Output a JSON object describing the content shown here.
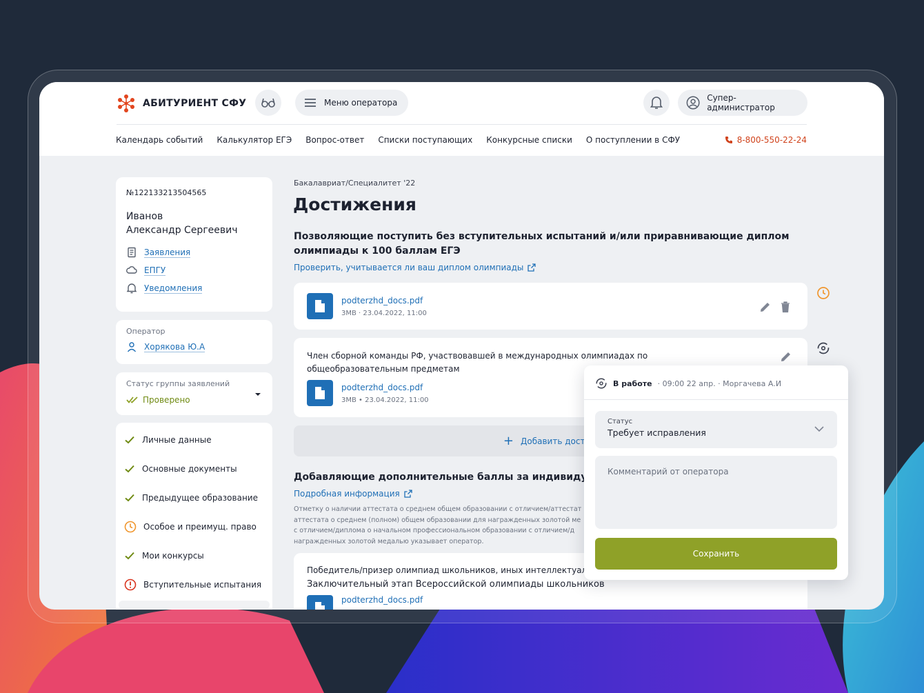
{
  "header": {
    "logo_text": "АБИТУРИЕНТ СФУ",
    "operator_menu_label": "Меню оператора",
    "user_label": "Супер-администратор",
    "nav": [
      "Календарь событий",
      "Калькулятор ЕГЭ",
      "Вопрос-ответ",
      "Списки поступающих",
      "Конкурсные списки",
      "О поступлении в СФУ"
    ],
    "phone": "8-800-550-22-24"
  },
  "profile": {
    "number": "№122133213504565",
    "last_name": "Иванов",
    "full_name": "Александр Сергеевич",
    "links": [
      "Заявления",
      "ЕПГУ",
      "Уведомления"
    ]
  },
  "operator": {
    "label": "Оператор",
    "name": "Хорякова Ю.А"
  },
  "group_status": {
    "label": "Статус группы заявлений",
    "value": "Проверено"
  },
  "steps": [
    {
      "label": "Личные данные",
      "state": "done"
    },
    {
      "label": "Основные документы",
      "state": "done"
    },
    {
      "label": "Предыдущее образование",
      "state": "done"
    },
    {
      "label": "Особое и преимущ. право",
      "state": "pending"
    },
    {
      "label": "Мои конкурсы",
      "state": "done"
    },
    {
      "label": "Вступительные испытания",
      "state": "error"
    }
  ],
  "main": {
    "breadcrumb": "Бакалавриат/Специалитет '22",
    "title": "Достижения",
    "section1_title": "Позволяющие поступить без вступительных испытаний и/или приравнивающие диплом олимпиады к 100 баллам ЕГЭ",
    "section1_link": "Проверить, учитывается ли ваш диплом олимпиады",
    "file1": {
      "name": "podterzhd_docs.pdf",
      "meta": "3MB · 23.04.2022, 11:00"
    },
    "item2_title": "Член сборной команды РФ, участвовавшей в международных олимпиадах по общеобразовательным предметам",
    "file2": {
      "name": "podterzhd_docs.pdf",
      "meta": "3MB • 23.04.2022, 11:00"
    },
    "add_label": "Добавить достиж",
    "section2_title": "Добавляющие дополнительные баллы за индивидуальные д",
    "section2_link": "Подробная информация",
    "section2_text": [
      "Отметку о наличии аттестата о среднем общем образовании с отличием/аттестат",
      "аттестата о среднем (полном) общем образовании для награжденных золотой ме",
      "с отличием/диплома о начальном профессиональном образовании с отличием/д",
      "награжденных золотой медалью указывает оператор."
    ],
    "item3_title": "Победитель/призер олимпиад школьников, иных интеллектуальных м",
    "item3_sub": "Заключительный этап Всероссийской олимпиады школьников",
    "file3": {
      "name": "podterzhd_docs.pdf"
    }
  },
  "popup": {
    "status_word": "В работе",
    "meta": "· 09:00 22 апр. · Моргачева А.И",
    "status_label": "Статус",
    "status_value": "Требует исправления",
    "comment_placeholder": "Комментарий от оператора",
    "save_label": "Сохранить"
  },
  "colors": {
    "accent_green": "#8fa128",
    "link_blue": "#1f6fb6",
    "phone_red": "#d0421b",
    "pending_orange": "#f0962e",
    "error_red": "#d9341f"
  }
}
